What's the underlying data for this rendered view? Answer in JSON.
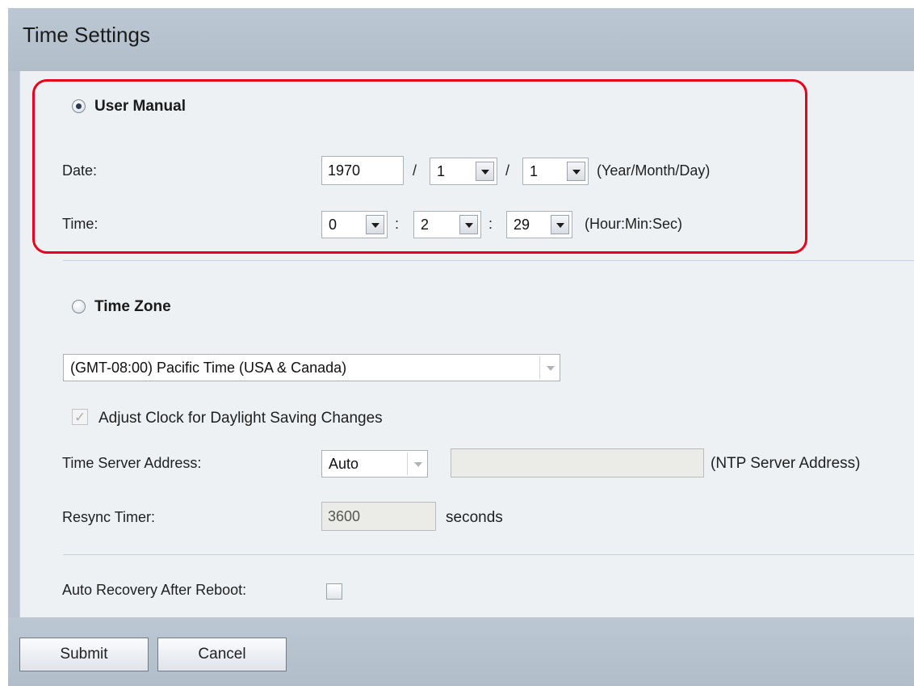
{
  "page": {
    "title": "Time Settings"
  },
  "user_manual": {
    "label": "User Manual",
    "selected": true,
    "date": {
      "label": "Date:",
      "year": "1970",
      "month": "1",
      "day": "1",
      "separator": "/",
      "hint": "(Year/Month/Day)"
    },
    "time": {
      "label": "Time:",
      "hour": "0",
      "minute": "2",
      "second": "29",
      "separator": ":",
      "hint": "(Hour:Min:Sec)"
    }
  },
  "time_zone": {
    "label": "Time Zone",
    "selected": false,
    "zone": "(GMT-08:00) Pacific Time (USA & Canada)",
    "daylight_label": "Adjust Clock for Daylight Saving Changes",
    "daylight_checked": true,
    "server_label": "Time Server Address:",
    "server_mode": "Auto",
    "server_value": "",
    "server_hint": "(NTP Server Address)",
    "resync_label": "Resync Timer:",
    "resync_value": "3600",
    "resync_unit": "seconds"
  },
  "auto_recovery": {
    "label": "Auto Recovery After Reboot:",
    "checked": false
  },
  "buttons": {
    "submit": "Submit",
    "cancel": "Cancel"
  },
  "colors": {
    "highlight": "#e8001c",
    "header": "#b8c3cf",
    "panel": "#eef1f4"
  }
}
